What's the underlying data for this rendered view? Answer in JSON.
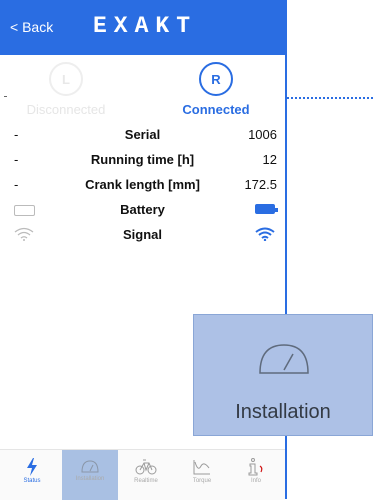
{
  "nav": {
    "back_label": "< Back",
    "logo": "EXAKT"
  },
  "sensors": {
    "left": {
      "letter": "L",
      "status": "Disconnected"
    },
    "right": {
      "letter": "R",
      "status": "Connected"
    }
  },
  "rows": [
    {
      "left": "-",
      "label": "Serial",
      "value": "1006"
    },
    {
      "left": "-",
      "label": "Running time [h]",
      "value": "12"
    },
    {
      "left": "-",
      "label": "Crank length [mm]",
      "value": "172.5"
    },
    {
      "label": "Battery",
      "left_icon": "battery-empty-icon",
      "right_icon": "battery-full-icon"
    },
    {
      "label": "Signal",
      "left_icon": "wifi-icon-gray",
      "right_icon": "wifi-icon-blue"
    }
  ],
  "tabs": [
    {
      "label": "Status",
      "icon": "lightning-icon"
    },
    {
      "label": "Installation",
      "icon": "gauge-icon"
    },
    {
      "label": "Realtime",
      "icon": "bicycle-icon"
    },
    {
      "label": "Torque",
      "icon": "torque-graph-icon"
    },
    {
      "label": "Info",
      "icon": "info-icon"
    }
  ],
  "zoom": {
    "label": "Installation",
    "icon": "gauge-icon"
  },
  "colors": {
    "accent": "#2a6de2",
    "tab_selected": "#a9c0e3",
    "zoom_bg": "#adc1e6"
  }
}
